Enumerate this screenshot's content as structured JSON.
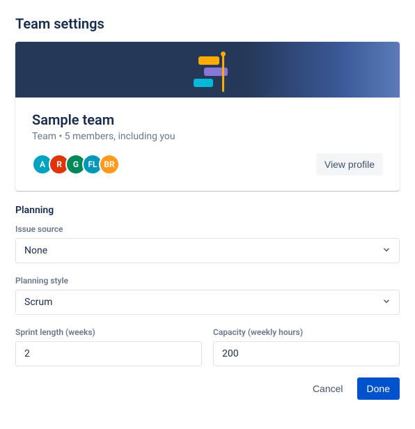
{
  "header": {
    "title": "Team settings"
  },
  "team": {
    "name": "Sample team",
    "meta": "Team • 5 members, including you",
    "avatars": [
      {
        "initials": "A",
        "color": "#00A3BF"
      },
      {
        "initials": "R",
        "color": "#DE350B"
      },
      {
        "initials": "G",
        "color": "#00875A"
      },
      {
        "initials": "FL",
        "color": "#0098B8"
      },
      {
        "initials": "BR",
        "color": "#FF991F"
      }
    ],
    "view_profile_label": "View profile"
  },
  "planning": {
    "section_title": "Planning",
    "issue_source": {
      "label": "Issue source",
      "value": "None"
    },
    "planning_style": {
      "label": "Planning style",
      "value": "Scrum"
    },
    "sprint_length": {
      "label": "Sprint length (weeks)",
      "value": "2"
    },
    "capacity": {
      "label": "Capacity (weekly hours)",
      "value": "200"
    }
  },
  "footer": {
    "cancel_label": "Cancel",
    "done_label": "Done"
  }
}
